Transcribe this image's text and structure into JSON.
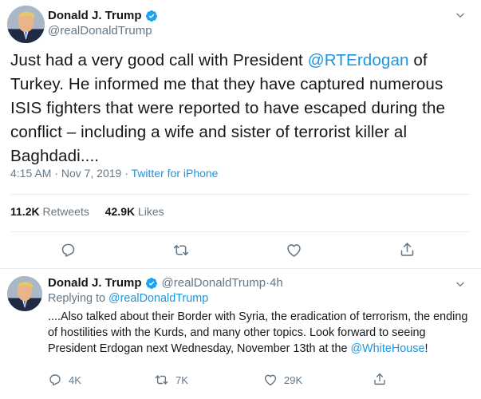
{
  "main_tweet": {
    "author_name": "Donald J. Trump",
    "author_handle": "@realDonaldTrump",
    "text_before_mention": "Just had a very good call with President ",
    "mention": "@RTErdogan",
    "text_after_mention": " of Turkey. He informed me that they have captured numerous ISIS fighters that were reported to have escaped during the conflict – including a wife and sister of terrorist killer al Baghdadi....",
    "time": "4:15 AM",
    "date": "Nov 7, 2019",
    "separator": " · ",
    "source": "Twitter for iPhone",
    "retweets_count": "11.2K",
    "retweets_label": "Retweets",
    "likes_count": "42.9K",
    "likes_label": "Likes"
  },
  "reply_tweet": {
    "author_name": "Donald J. Trump",
    "author_handle": "@realDonaldTrump",
    "time_ago": "4h",
    "separator": " · ",
    "replying_label": "Replying to ",
    "replying_to": "@realDonaldTrump",
    "text_before_mention": "....Also talked about their Border with Syria, the eradication of terrorism, the ending of hostilities with the Kurds, and many other topics. Look forward to seeing President Erdogan next Wednesday, November 13th at the ",
    "mention": "@WhiteHouse",
    "text_after_mention": "!",
    "reply_count": "4K",
    "retweet_count": "7K",
    "like_count": "29K"
  },
  "icons": {
    "verified": "verified-badge-icon",
    "chevron": "chevron-down-icon",
    "reply": "reply-icon",
    "retweet": "retweet-icon",
    "like": "heart-icon",
    "share": "share-icon"
  },
  "colors": {
    "link": "#1b95e0",
    "muted": "#657786",
    "text": "#14171a",
    "verified": "#1da1f2",
    "divider": "#e6ecf0"
  }
}
